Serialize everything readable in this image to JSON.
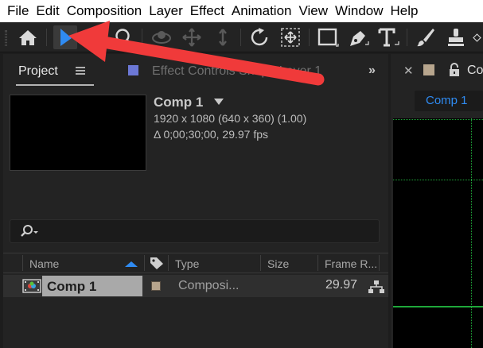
{
  "menubar": {
    "items": [
      "File",
      "Edit",
      "Composition",
      "Layer",
      "Effect",
      "Animation",
      "View",
      "Window",
      "Help"
    ]
  },
  "toolbar": {
    "tools": [
      "home-icon",
      "selection-tool-icon",
      "hand-tool-icon",
      "zoom-tool-icon",
      "orbit-tool-icon",
      "pan-tool-icon",
      "dolly-tool-icon",
      "rotate-tool-icon",
      "pan-behind-tool-icon",
      "rectangle-tool-icon",
      "pen-tool-icon",
      "type-tool-icon",
      "brush-tool-icon",
      "clone-stamp-tool-icon",
      "eraser-tool-icon"
    ],
    "active_tool": "selection-tool-icon"
  },
  "project_panel": {
    "tab_label": "Project",
    "second_tab_label": "Effect Controls  Shape Layer 1",
    "effect_color": "#6c78d6",
    "comp_name": "Comp 1",
    "comp_dimensions": "1920 x 1080  (640 x 360) (1.00)",
    "comp_duration": "Δ 0;00;30;00, 29.97 fps",
    "search_value": ""
  },
  "table": {
    "headers": {
      "name": "Name",
      "type": "Type",
      "size": "Size",
      "frame_rate": "Frame R..."
    },
    "rows": [
      {
        "name": "Comp 1",
        "label_color": "#b7a58d",
        "type": "Composi...",
        "size": "",
        "frame_rate": "29.97"
      }
    ]
  },
  "comp_panel": {
    "tab_label": "Co",
    "sub_tab_label": "Comp 1",
    "label_color": "#b7a58d",
    "guide_color": "#1fa83a"
  },
  "colors": {
    "accent_blue": "#2f8bf2",
    "annotation_red": "#f03a3a"
  }
}
